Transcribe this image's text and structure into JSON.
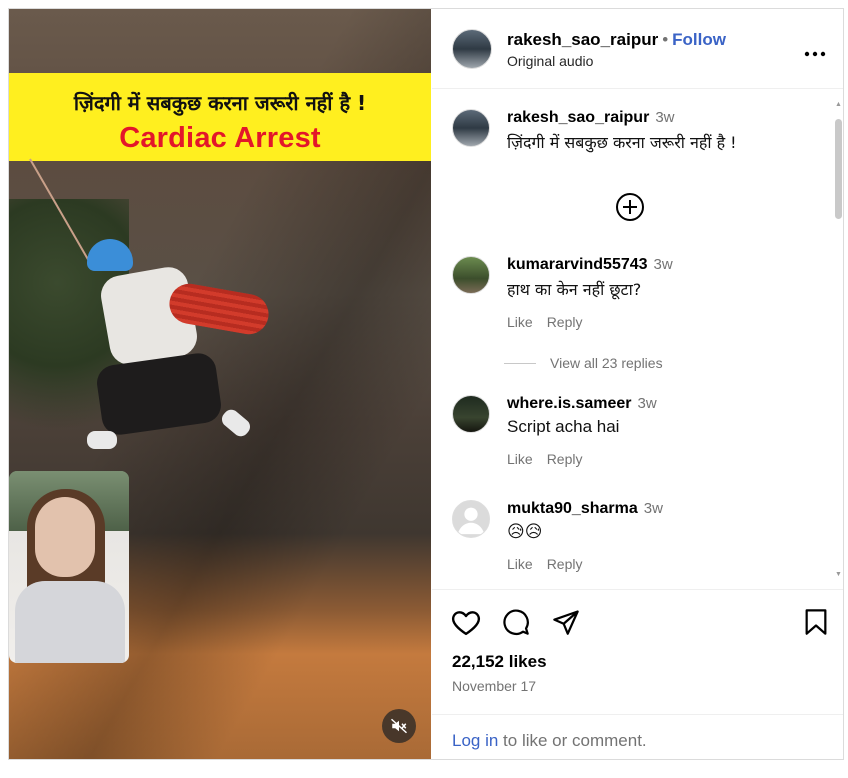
{
  "post": {
    "username": "rakesh_sao_raipur",
    "follow_label": "Follow",
    "separator": "•",
    "audio": "Original audio",
    "more_label": "•••"
  },
  "media": {
    "caption_hindi": "ज़िंदगी में सबकुछ करना जरूरी नहीं है !",
    "caption_english": "Cardiac Arrest",
    "mute_icon": "speaker-muted-icon"
  },
  "comments": [
    {
      "username": "rakesh_sao_raipur",
      "time": "3w",
      "text": "ज़िंदगी में सबकुछ करना जरूरी नहीं है !"
    },
    {
      "username": "kumararvind55743",
      "time": "3w",
      "text": "हाथ का केन नहीं छूटा?",
      "like": "Like",
      "reply": "Reply",
      "view_replies": "View all 23 replies"
    },
    {
      "username": "where.is.sameer",
      "time": "3w",
      "text": "Script acha hai",
      "like": "Like",
      "reply": "Reply"
    },
    {
      "username": "mukta90_sharma",
      "time": "3w",
      "text": "😥😥",
      "like": "Like",
      "reply": "Reply"
    }
  ],
  "stats": {
    "likes": "22,152 likes",
    "date": "November 17"
  },
  "footer": {
    "login_link": "Log in",
    "login_rest": " to like or comment."
  },
  "colors": {
    "link_blue": "#3a63c6",
    "caption_yellow": "#ffef1f",
    "caption_red": "#e3162a"
  }
}
